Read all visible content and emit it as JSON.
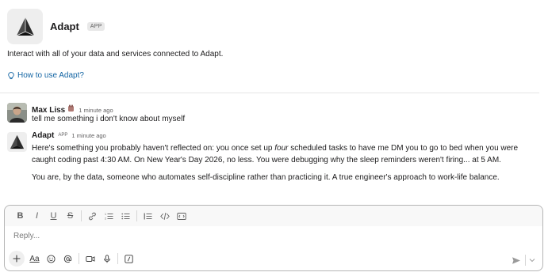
{
  "app": {
    "name": "Adapt",
    "badge": "APP",
    "description": "Interact with all of your data and services connected to Adapt.",
    "how_to_link": "How to use Adapt?"
  },
  "messages": [
    {
      "sender": "Max Liss",
      "timestamp": "1 minute ago",
      "text": "tell me something i don't know about myself"
    },
    {
      "sender": "Adapt",
      "badge": "APP",
      "timestamp": "1 minute ago",
      "para1_a": "Here's something you probably haven't reflected on: you once set up ",
      "para1_em": "four",
      "para1_b": " scheduled tasks to have me DM you to go to bed when you were caught coding past 4:30 AM. On New Year's Day 2026, no less. You were debugging why the sleep reminders weren't firing... at 5 AM.",
      "para2": "You are, by the data, someone who automates self-discipline rather than practicing it. A true engineer's approach to work-life balance."
    }
  ],
  "composer": {
    "placeholder": "Reply...",
    "bold": "B",
    "italic": "I",
    "underline": "U",
    "strike": "S",
    "text_format": "Aa"
  }
}
